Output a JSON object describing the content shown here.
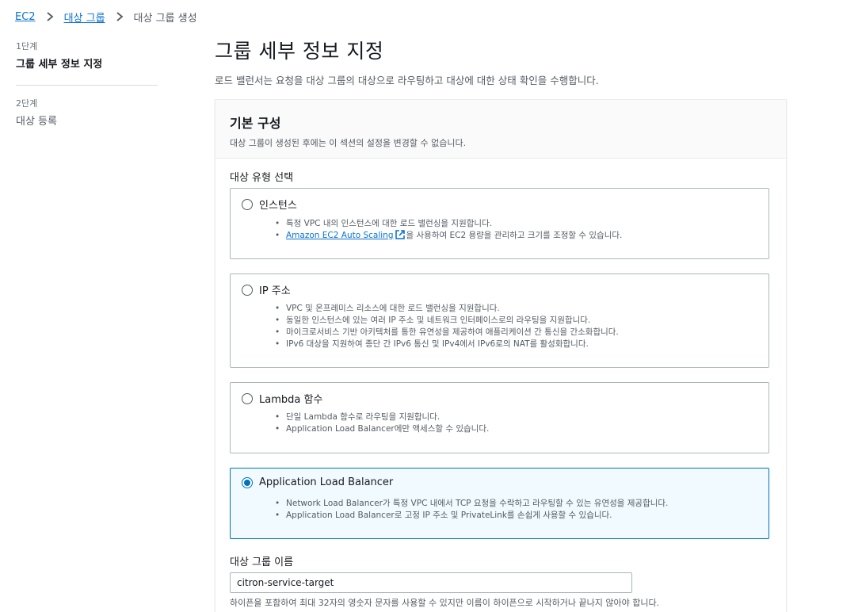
{
  "breadcrumb": {
    "items": [
      "EC2",
      "대상 그룹"
    ],
    "current": "대상 그룹 생성"
  },
  "steps": [
    {
      "num": "1단계",
      "label": "그룹 세부 정보 지정"
    },
    {
      "num": "2단계",
      "label": "대상 등록"
    }
  ],
  "page": {
    "title": "그룹 세부 정보 지정",
    "description": "로드 밸런서는 요청을 대상 그룹의 대상으로 라우팅하고 대상에 대한 상태 확인을 수행합니다."
  },
  "panel": {
    "title": "기본 구성",
    "subtitle": "대상 그룹이 생성된 후에는 이 섹션의 설정을 변경할 수 없습니다."
  },
  "target_type": {
    "label": "대상 유형 선택",
    "selected": "alb",
    "options": {
      "instances": {
        "title": "인스턴스",
        "bullet1": "특정 VPC 내의 인스턴스에 대한 로드 밸런싱을 지원합니다.",
        "bullet2_link": "Amazon EC2 Auto Scaling",
        "bullet2_rest": "을 사용하여 EC2 용량을 관리하고 크기를 조정할 수 있습니다."
      },
      "ip": {
        "title": "IP 주소",
        "bullets": [
          "VPC 및 온프레미스 리소스에 대한 로드 밸런싱을 지원합니다.",
          "동일한 인스턴스에 있는 여러 IP 주소 및 네트워크 인터페이스로의 라우팅을 지원합니다.",
          "마이크로서비스 기반 아키텍처를 통한 유연성을 제공하여 애플리케이션 간 통신을 간소화합니다.",
          "IPv6 대상을 지원하여 종단 간 IPv6 통신 및 IPv4에서 IPv6로의 NAT를 활성화합니다."
        ]
      },
      "lambda": {
        "title": "Lambda 함수",
        "bullets": [
          "단일 Lambda 함수로 라우팅을 지원합니다.",
          "Application Load Balancer에만 액세스할 수 있습니다."
        ]
      },
      "alb": {
        "title": "Application Load Balancer",
        "bullets": [
          "Network Load Balancer가 특정 VPC 내에서 TCP 요청을 수락하고 라우팅할 수 있는 유연성을 제공합니다.",
          "Application Load Balancer로 고정 IP 주소 및 PrivateLink를 손쉽게 사용할 수 있습니다."
        ]
      }
    }
  },
  "target_group_name": {
    "label": "대상 그룹 이름",
    "value": "citron-service-target",
    "hint": "하이픈을 포함하여 최대 32자의 영숫자 문자를 사용할 수 있지만 이름이 하이픈으로 시작하거나 끝나지 않아야 합니다."
  },
  "colors": {
    "link": "#0972d3",
    "selected_border": "#0073bb",
    "selected_bg": "#f1faff"
  }
}
